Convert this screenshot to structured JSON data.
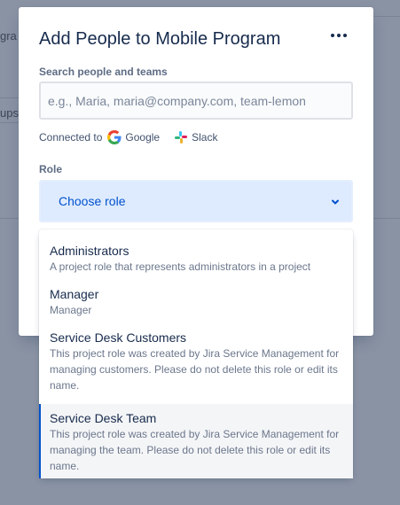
{
  "background": {
    "fragment_1": "gra",
    "fragment_2": "ups"
  },
  "modal": {
    "title": "Add People to Mobile Program",
    "more_icon": "more-horizontal-icon",
    "search": {
      "label": "Search people and teams",
      "placeholder": "e.g., Maria, maria@company.com, team-lemon",
      "value": ""
    },
    "connected": {
      "label": "Connected to",
      "services": [
        {
          "name": "Google",
          "icon": "google-icon"
        },
        {
          "name": "Slack",
          "icon": "slack-icon"
        }
      ]
    },
    "role": {
      "label": "Role",
      "value": "Choose role",
      "chevron_icon": "chevron-down-icon"
    }
  },
  "role_menu": {
    "options": [
      {
        "title": "Administrators",
        "description": "A project role that represents administrators in a project"
      },
      {
        "title": "Manager",
        "description": "Manager"
      },
      {
        "title": "Service Desk Customers",
        "description": "This project role was created by Jira Service Management for managing customers. Please do not delete this role or edit its name."
      },
      {
        "title": "Service Desk Team",
        "description": "This project role was created by Jira Service Management for managing the team. Please do not delete this role or edit its name.",
        "highlighted": true
      }
    ]
  },
  "colors": {
    "overlay": "#8993a4",
    "accent": "#0052cc",
    "select_bg": "#deebff",
    "text": "#172b4d",
    "subtle_text": "#6b778c"
  }
}
